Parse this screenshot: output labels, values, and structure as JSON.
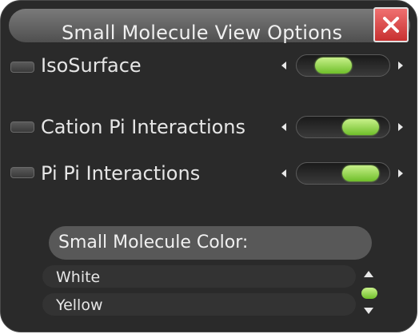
{
  "window": {
    "title": "Small Molecule View Options",
    "close_icon": "close-x-icon"
  },
  "options": [
    {
      "label": "IsoSurface",
      "checked": false,
      "slider_level": 0.3
    },
    {
      "label": "Cation Pi Interactions",
      "checked": false,
      "slider_level": 0.85
    },
    {
      "label": "Pi Pi Interactions",
      "checked": false,
      "slider_level": 0.85
    }
  ],
  "color_section": {
    "title": "Small Molecule Color:",
    "items": [
      "White",
      "Yellow"
    ],
    "scroll_level": 0.5
  },
  "colors": {
    "panel_bg": "#2a2a2a",
    "accent_green": "#7fcf3a",
    "close_red": "#d94040"
  }
}
